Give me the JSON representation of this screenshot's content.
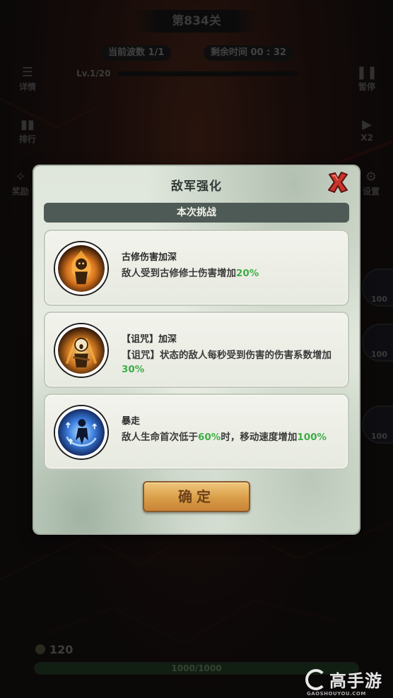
{
  "hud": {
    "level_title": "第834关",
    "wave": "当前波数  1/1",
    "timer": "剩余时间  00 : 32",
    "player_level": "Lv.1/20",
    "left_buttons": [
      "详情",
      "排行",
      "奖励"
    ],
    "right_buttons": [
      "暂停",
      "X2",
      "设置"
    ],
    "hero_levels": [
      "100",
      "100",
      "100"
    ],
    "gold": "120",
    "base_hp": "1000/1000"
  },
  "modal": {
    "title": "敌军强化",
    "section": "本次挑战",
    "cards": [
      {
        "icon": "burning-figure-icon",
        "title": "古修伤害加深",
        "desc_parts": [
          "敌人受到古修修士伤害增加",
          "20%",
          ""
        ]
      },
      {
        "icon": "cursed-figure-icon",
        "title": "【诅咒】加深",
        "desc_parts": [
          "【诅咒】状态的敌人每秒受到伤害的伤害系数增加",
          "30%",
          ""
        ]
      },
      {
        "icon": "frenzy-figure-icon",
        "title": "暴走",
        "desc_parts": [
          "敌人生命首次低于",
          "60%",
          "时，移动速度增加",
          "100%"
        ]
      }
    ],
    "confirm_label": "确定"
  },
  "watermark": {
    "text": "高手游",
    "url": "GAOSHOUYOU.COM"
  },
  "colors": {
    "highlight": "#3fae47",
    "button": "#d99d47",
    "section_bar": "#4e5a55"
  }
}
